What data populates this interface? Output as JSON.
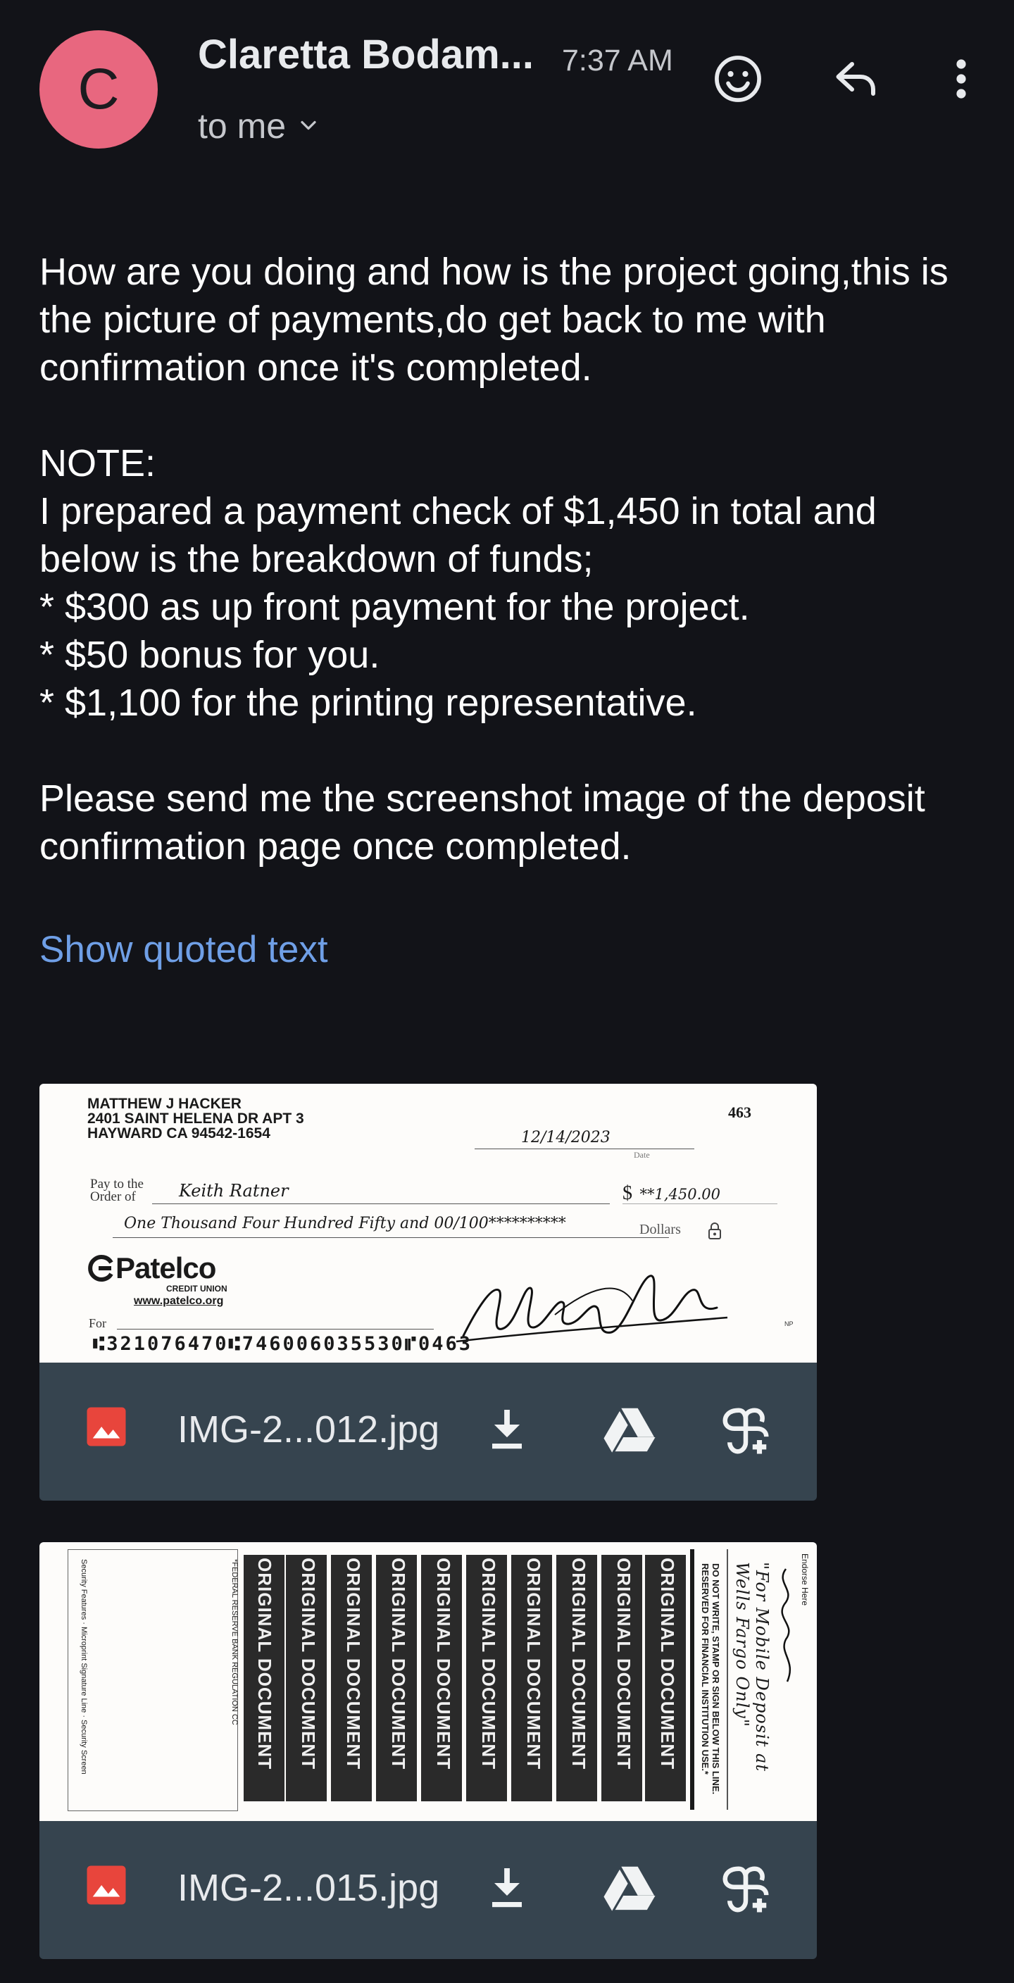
{
  "header": {
    "avatar_letter": "C",
    "sender": "Claretta Bodam...",
    "time": "7:37 AM",
    "recipient": "to me"
  },
  "message": {
    "body": "How are you doing and how is the project going,this is the picture of payments,do get back to me with confirmation once it's completed.\n\nNOTE:\nI prepared a payment check of $1,450 in total and below is the breakdown of funds;\n* $300 as up front payment for the project.\n* $50 bonus for you.\n* $1,100 for the printing representative.\n\nPlease send me the screenshot image of the deposit confirmation page once completed.",
    "show_quoted": "Show quoted text"
  },
  "attachments": [
    {
      "filename": "IMG-2...012.jpg",
      "check_front": {
        "name": "MATTHEW J HACKER",
        "address1": "2401 SAINT HELENA DR APT 3",
        "address2": "HAYWARD CA 94542-1654",
        "check_no": "463",
        "date": "12/14/2023",
        "date_label": "Date",
        "pay_to_label": "Pay to the",
        "order_of_label": "Order of",
        "payee": "Keith Ratner",
        "amount_symbol": "$",
        "amount": "**1,450.00",
        "amount_words": "One Thousand Four Hundred Fifty and 00/100**********",
        "dollars_label": "Dollars",
        "bank_name": "Patelco",
        "bank_sub": "CREDIT UNION",
        "bank_url": "www.patelco.org",
        "for_label": "For",
        "micr": "⑆321076470⑆746006035530⑈0463",
        "np_label": "NP"
      }
    },
    {
      "filename": "IMG-2...015.jpg",
      "check_back": {
        "endorse_label": "Endorse Here",
        "endorse_note": "\"For Mobile Deposit at Wells Fargo Only\"",
        "do_not_write": "DO NOT WRITE, STAMP OR SIGN BELOW THIS LINE. RESERVED FOR FINANCIAL INSTITUTION USE.*",
        "watermark": "ORIGINAL DOCUMENT",
        "regulation": "*FEDERAL RESERVE BANK REGULATION CC"
      }
    }
  ],
  "colors": {
    "background": "#121318",
    "avatar": "#e8677f",
    "link": "#6f9fe6",
    "attachment_bar": "#36444f",
    "image_icon": "#e8453c"
  }
}
